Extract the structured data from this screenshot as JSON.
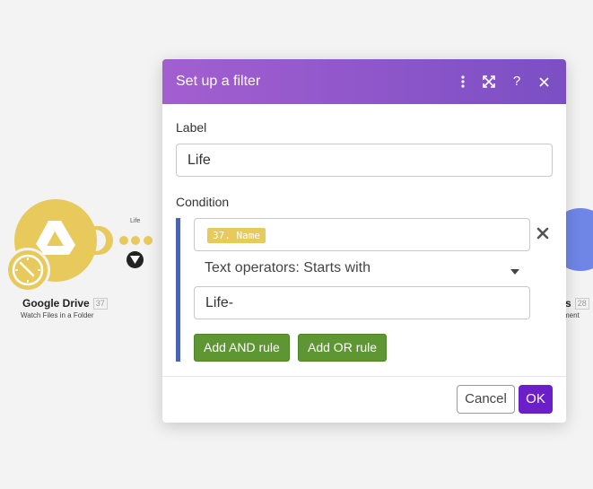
{
  "scenario": {
    "source_module": {
      "title": "Google Drive",
      "id": "37",
      "subtitle": "Watch Files in a Folder",
      "icon": "google-drive-icon",
      "badge_icon": "clock-icon",
      "color": "#e8c95c"
    },
    "route": {
      "label": "Life",
      "filter_icon": "funnel-icon"
    },
    "target_module": {
      "title_partial": "s",
      "id": "28",
      "subtitle_partial": "ment",
      "color": "#6f86e6"
    }
  },
  "dialog": {
    "title": "Set up a filter",
    "header_color": "#8b57c9",
    "header_icons": [
      "more-vertical-icon",
      "expand-icon",
      "help-icon",
      "close-icon"
    ],
    "help_glyph": "?",
    "label_section": "Label",
    "label_value": "Life",
    "condition_section": "Condition",
    "condition": {
      "field_pill": "37. Name",
      "operator": "Text operators: Starts with",
      "value": "Life-"
    },
    "add_and_rule": "Add AND rule",
    "add_or_rule": "Add OR rule",
    "cancel": "Cancel",
    "ok": "OK"
  }
}
